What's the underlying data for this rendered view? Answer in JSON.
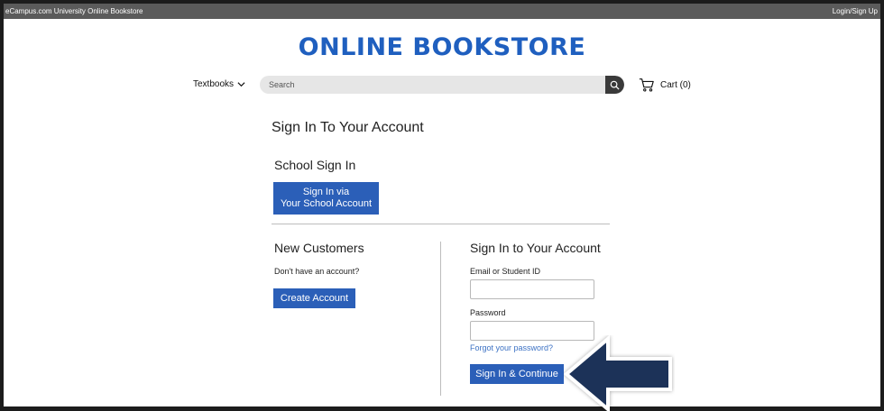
{
  "topbar": {
    "site_name": "eCampus.com University Online Bookstore",
    "login_link": "Login/Sign Up"
  },
  "header": {
    "logo_text": "ONLINE BOOKSTORE",
    "textbooks_menu": "Textbooks",
    "search_placeholder": "Search",
    "cart_label": "Cart (0)"
  },
  "main": {
    "title": "Sign In To Your Account",
    "school_section": {
      "heading": "School Sign In",
      "button_line1": "Sign In via",
      "button_line2": "Your School Account"
    },
    "new_customers": {
      "heading": "New Customers",
      "text": "Don't have an account?",
      "button": "Create Account"
    },
    "sign_in": {
      "heading": "Sign In to Your Account",
      "email_label": "Email or Student ID",
      "email_value": "",
      "password_label": "Password",
      "password_value": "",
      "forgot_link": "Forgot your password?",
      "submit_button": "Sign In & Continue"
    }
  },
  "colors": {
    "brand_blue": "#2b5fb8",
    "topbar_gray": "#5b5b5b",
    "arrow_navy": "#1f3358"
  }
}
